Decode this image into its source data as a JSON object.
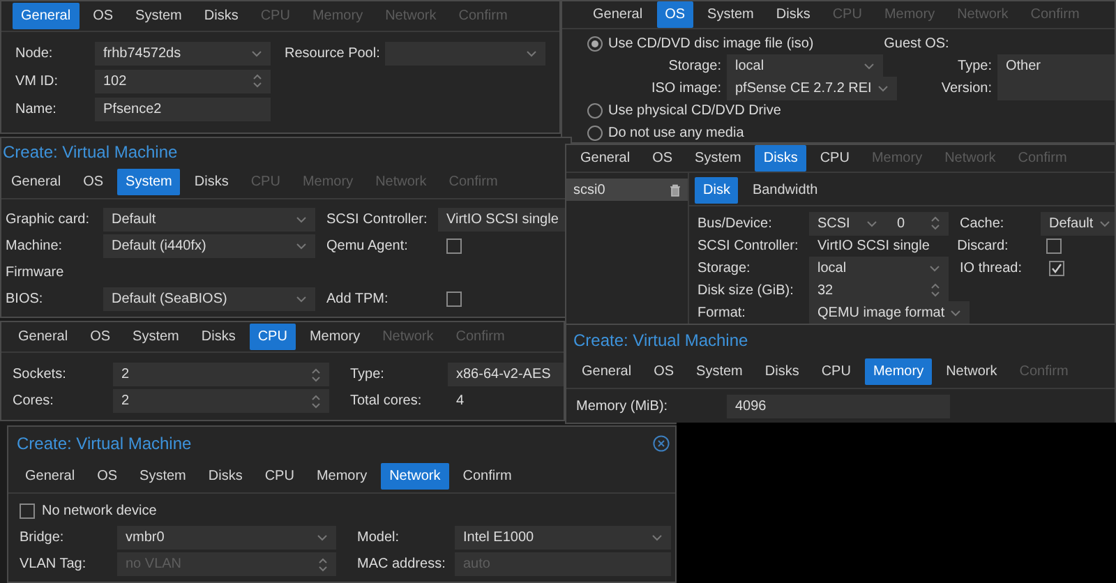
{
  "panels": [
    {
      "tabs": [
        {
          "label": "General",
          "selected": true,
          "disabled": false
        },
        {
          "label": "OS",
          "selected": false,
          "disabled": false
        },
        {
          "label": "System",
          "selected": false,
          "disabled": false
        },
        {
          "label": "Disks",
          "selected": false,
          "disabled": false
        },
        {
          "label": "CPU",
          "selected": false,
          "disabled": true
        },
        {
          "label": "Memory",
          "selected": false,
          "disabled": true
        },
        {
          "label": "Network",
          "selected": false,
          "disabled": true
        },
        {
          "label": "Confirm",
          "selected": false,
          "disabled": true
        }
      ],
      "rows": [
        {
          "left": {
            "kind": "combo",
            "label": "Node:",
            "value": "frhb74572ds"
          },
          "right": {
            "kind": "combo",
            "label": "Resource Pool:"
          }
        },
        {
          "left": {
            "kind": "spin",
            "label": "VM ID:",
            "value": "102"
          }
        },
        {
          "left": {
            "kind": "text",
            "label": "Name:",
            "value": "Pfsence2"
          }
        }
      ]
    },
    {
      "tabs": [
        {
          "label": "General",
          "selected": false,
          "disabled": false
        },
        {
          "label": "OS",
          "selected": true,
          "disabled": false
        },
        {
          "label": "System",
          "selected": false,
          "disabled": false
        },
        {
          "label": "Disks",
          "selected": false,
          "disabled": false
        },
        {
          "label": "CPU",
          "selected": false,
          "disabled": true
        },
        {
          "label": "Memory",
          "selected": false,
          "disabled": true
        },
        {
          "label": "Network",
          "selected": false,
          "disabled": true
        },
        {
          "label": "Confirm",
          "selected": false,
          "disabled": true
        }
      ],
      "rows": [
        {
          "left": {
            "kind": "radio",
            "label": "Use CD/DVD disc image file (iso)",
            "selected": true
          },
          "right": {
            "kind": "heading",
            "label": "Guest OS:"
          }
        },
        {
          "left": {
            "kind": "combo",
            "label": "Storage:",
            "value": "local"
          },
          "right": {
            "kind": "combo",
            "label": "Type:",
            "value": "Other"
          }
        },
        {
          "left": {
            "kind": "combo",
            "label": "ISO image:",
            "value": "pfSense CE 2.7.2 REI"
          },
          "right": {
            "kind": "combo",
            "label": "Version:"
          }
        },
        {
          "left": {
            "kind": "radio",
            "label": "Use physical CD/DVD Drive",
            "selected": false
          }
        },
        {
          "left": {
            "kind": "radio",
            "label": "Do not use any media",
            "selected": false
          }
        }
      ]
    },
    {
      "title": "Create: Virtual Machine",
      "tabs": [
        {
          "label": "General",
          "selected": false,
          "disabled": false
        },
        {
          "label": "OS",
          "selected": false,
          "disabled": false
        },
        {
          "label": "System",
          "selected": true,
          "disabled": false
        },
        {
          "label": "Disks",
          "selected": false,
          "disabled": false
        },
        {
          "label": "CPU",
          "selected": false,
          "disabled": true
        },
        {
          "label": "Memory",
          "selected": false,
          "disabled": true
        },
        {
          "label": "Network",
          "selected": false,
          "disabled": true
        },
        {
          "label": "Confirm",
          "selected": false,
          "disabled": true
        }
      ],
      "rows": [
        {
          "left": {
            "kind": "combo",
            "label": "Graphic card:",
            "value": "Default"
          },
          "right": {
            "kind": "text",
            "label": "SCSI Controller:",
            "value": "VirtIO SCSI single"
          }
        },
        {
          "left": {
            "kind": "combo",
            "label": "Machine:",
            "value": "Default (i440fx)"
          },
          "right": {
            "kind": "check",
            "label": "Qemu Agent:",
            "checked": false
          }
        },
        {
          "left": {
            "kind": "heading",
            "label": "Firmware"
          }
        },
        {
          "left": {
            "kind": "combo",
            "label": "BIOS:",
            "value": "Default (SeaBIOS)"
          },
          "right": {
            "kind": "check",
            "label": "Add TPM:",
            "checked": false
          }
        }
      ]
    },
    {
      "tabs": [
        {
          "label": "General",
          "selected": false,
          "disabled": false
        },
        {
          "label": "OS",
          "selected": false,
          "disabled": false
        },
        {
          "label": "System",
          "selected": false,
          "disabled": false
        },
        {
          "label": "Disks",
          "selected": true,
          "disabled": false
        },
        {
          "label": "CPU",
          "selected": false,
          "disabled": false
        },
        {
          "label": "Memory",
          "selected": false,
          "disabled": true
        },
        {
          "label": "Network",
          "selected": false,
          "disabled": true
        },
        {
          "label": "Confirm",
          "selected": false,
          "disabled": true
        }
      ],
      "sidebar": [
        {
          "label": "scsi0",
          "selected": true
        }
      ],
      "subtabs": [
        {
          "label": "Disk",
          "selected": true
        },
        {
          "label": "Bandwidth",
          "selected": false
        }
      ],
      "rows": [
        {
          "left": {
            "kind": "combo-spin",
            "label": "Bus/Device:",
            "value": "SCSI",
            "number": "0"
          },
          "right": {
            "kind": "combo",
            "label": "Cache:",
            "value": "Default"
          }
        },
        {
          "left": {
            "kind": "static",
            "label": "SCSI Controller:",
            "value": "VirtIO SCSI single"
          },
          "right": {
            "kind": "check",
            "label": "Discard:",
            "checked": false
          }
        },
        {
          "left": {
            "kind": "combo",
            "label": "Storage:",
            "value": "local"
          },
          "right": {
            "kind": "check",
            "label": "IO thread:",
            "checked": true
          }
        },
        {
          "left": {
            "kind": "spin",
            "label": "Disk size (GiB):",
            "value": "32"
          }
        },
        {
          "left": {
            "kind": "combo",
            "label": "Format:",
            "value": "QEMU image format"
          }
        }
      ]
    },
    {
      "tabs": [
        {
          "label": "General",
          "selected": false,
          "disabled": false
        },
        {
          "label": "OS",
          "selected": false,
          "disabled": false
        },
        {
          "label": "System",
          "selected": false,
          "disabled": false
        },
        {
          "label": "Disks",
          "selected": false,
          "disabled": false
        },
        {
          "label": "CPU",
          "selected": true,
          "disabled": false
        },
        {
          "label": "Memory",
          "selected": false,
          "disabled": false
        },
        {
          "label": "Network",
          "selected": false,
          "disabled": true
        },
        {
          "label": "Confirm",
          "selected": false,
          "disabled": true
        }
      ],
      "rows": [
        {
          "left": {
            "kind": "spin",
            "label": "Sockets:",
            "value": "2"
          },
          "right": {
            "kind": "text",
            "label": "Type:",
            "value": "x86-64-v2-AES"
          }
        },
        {
          "left": {
            "kind": "spin",
            "label": "Cores:",
            "value": "2"
          },
          "right": {
            "kind": "static",
            "label": "Total cores:",
            "value": "4"
          }
        }
      ]
    },
    {
      "title": "Create: Virtual Machine",
      "tabs": [
        {
          "label": "General",
          "selected": false,
          "disabled": false
        },
        {
          "label": "OS",
          "selected": false,
          "disabled": false
        },
        {
          "label": "System",
          "selected": false,
          "disabled": false
        },
        {
          "label": "Disks",
          "selected": false,
          "disabled": false
        },
        {
          "label": "CPU",
          "selected": false,
          "disabled": false
        },
        {
          "label": "Memory",
          "selected": true,
          "disabled": false
        },
        {
          "label": "Network",
          "selected": false,
          "disabled": false
        },
        {
          "label": "Confirm",
          "selected": false,
          "disabled": true
        }
      ],
      "rows": [
        {
          "left": {
            "kind": "text",
            "label": "Memory (MiB):",
            "value": "4096"
          }
        }
      ]
    },
    {
      "title": "Create: Virtual Machine",
      "closable": true,
      "tabs": [
        {
          "label": "General",
          "selected": false,
          "disabled": false
        },
        {
          "label": "OS",
          "selected": false,
          "disabled": false
        },
        {
          "label": "System",
          "selected": false,
          "disabled": false
        },
        {
          "label": "Disks",
          "selected": false,
          "disabled": false
        },
        {
          "label": "CPU",
          "selected": false,
          "disabled": false
        },
        {
          "label": "Memory",
          "selected": false,
          "disabled": false
        },
        {
          "label": "Network",
          "selected": true,
          "disabled": false
        },
        {
          "label": "Confirm",
          "selected": false,
          "disabled": false
        }
      ],
      "rows": [
        {
          "left": {
            "kind": "option",
            "label": "No network device",
            "checked": false
          }
        },
        {
          "left": {
            "kind": "combo",
            "label": "Bridge:",
            "value": "vmbr0"
          },
          "right": {
            "kind": "combo",
            "label": "Model:",
            "value": "Intel E1000"
          }
        },
        {
          "left": {
            "kind": "spin",
            "label": "VLAN Tag:",
            "placeholder": "no VLAN"
          },
          "right": {
            "kind": "text",
            "label": "MAC address:",
            "placeholder": "auto"
          }
        }
      ]
    }
  ]
}
